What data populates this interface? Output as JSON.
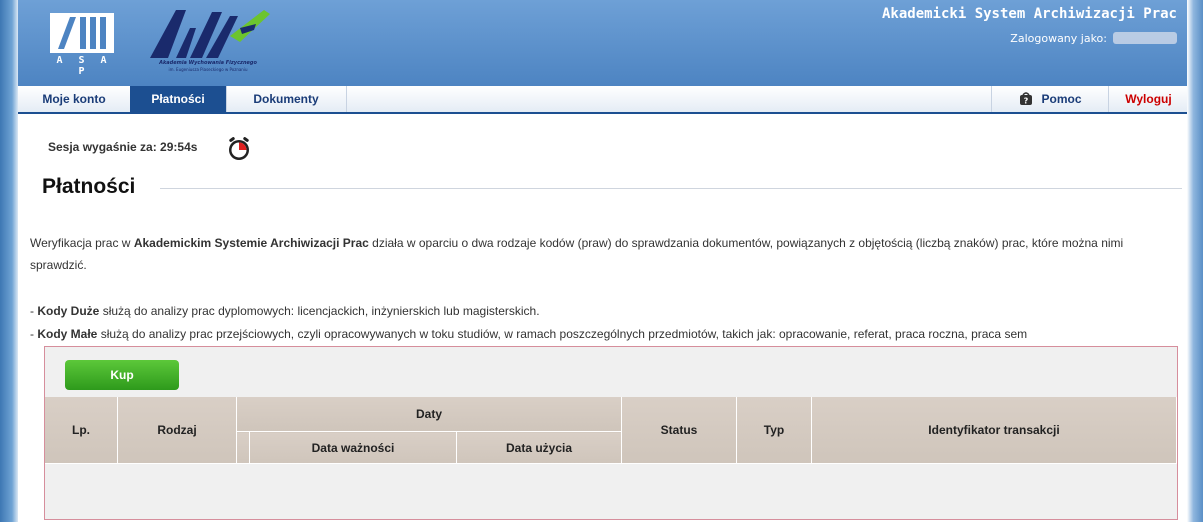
{
  "header": {
    "logo_asap": "A S A P",
    "logo_awf_line1": "Akademia Wychowania Fizycznego",
    "logo_awf_line2": "im. Eugeniusza Piaseckiego w Poznaniu",
    "app_title": "Akademicki System Archiwizacji Prac",
    "logged_as": "Zalogowany jako:"
  },
  "tabs": {
    "moje_konto": "Moje konto",
    "platnosci": "Płatności",
    "dokumenty": "Dokumenty",
    "pomoc": "Pomoc",
    "wyloguj": "Wyloguj"
  },
  "session": {
    "label": "Sesja wygaśnie za: 29:54s"
  },
  "page": {
    "title": "Płatności",
    "desc_pre": "Weryfikacja prac w ",
    "desc_bold": "Akademickim Systemie Archiwizacji Prac",
    "desc_post": " działa w oparciu o dwa rodzaje kodów (praw) do sprawdzania dokumentów, powiązanych z objętością (liczbą znaków) prac, które można nimi sprawdzić.",
    "duze_dash": "- ",
    "duze_bold": "Kody Duże",
    "duze_text": " służą do analizy prac dyplomowych: licencjackich, inżynierskich lub magisterskich.",
    "male_dash": "- ",
    "male_bold": "Kody Małe",
    "male_text": " służą do analizy prac przejściowych, czyli opracowywanych w toku studiów, w ramach poszczególnych przedmiotów, takich jak: opracowanie, referat, praca roczna, praca sem"
  },
  "panel": {
    "buy_button": "Kup",
    "columns": {
      "lp": "Lp.",
      "rodzaj": "Rodzaj",
      "daty": "Daty",
      "data_waznosci": "Data ważności",
      "data_uzycia": "Data użycia",
      "status": "Status",
      "typ": "Typ",
      "identyfikator": "Identyfikator transakcji"
    }
  },
  "colors": {
    "header_blue": "#4d84c2",
    "tab_active": "#1c4f91",
    "logout_red": "#cc0000",
    "button_green": "#3aa82a",
    "panel_border": "#d68e9c"
  }
}
